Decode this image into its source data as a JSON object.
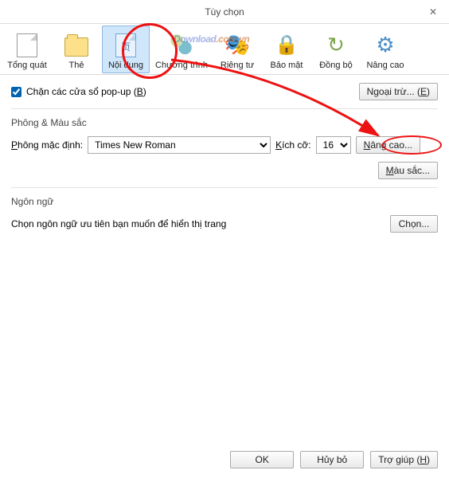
{
  "window": {
    "title": "Tùy chọn",
    "close": "✕"
  },
  "watermark": {
    "text": "Download",
    "suffix": ".com.vn"
  },
  "toolbar": {
    "items": [
      {
        "id": "general",
        "label": "Tổng quát"
      },
      {
        "id": "tabs",
        "label": "Thẻ"
      },
      {
        "id": "content",
        "label": "Nội dung",
        "selected": true
      },
      {
        "id": "programs",
        "label": "Chương trình"
      },
      {
        "id": "privacy",
        "label": "Riêng tư"
      },
      {
        "id": "security",
        "label": "Bảo mật"
      },
      {
        "id": "sync",
        "label": "Đồng bộ"
      },
      {
        "id": "advanced",
        "label": "Nâng cao"
      }
    ]
  },
  "popup": {
    "checkbox_label_pre": "Chặn các cửa sổ pop-up (",
    "checkbox_key": "B",
    "checkbox_label_post": ")",
    "checked": true,
    "exceptions_pre": "Ngoại trừ... (",
    "exceptions_key": "E",
    "exceptions_post": ")"
  },
  "fonts": {
    "section": "Phông & Màu sắc",
    "default_label_pre": "Phông mặc định:",
    "font_value": "Times New Roman",
    "size_label": "Kích cỡ:",
    "size_value": "16",
    "advanced_btn": "Nâng cao...",
    "colors_btn": "Màu sắc..."
  },
  "lang": {
    "section": "Ngôn ngữ",
    "desc": "Chọn ngôn ngữ ưu tiên bạn muốn để hiển thị trang",
    "choose_btn": "Chọn..."
  },
  "footer": {
    "ok": "OK",
    "cancel": "Hủy bỏ",
    "help_pre": "Trợ giúp (",
    "help_key": "H",
    "help_post": ")"
  }
}
